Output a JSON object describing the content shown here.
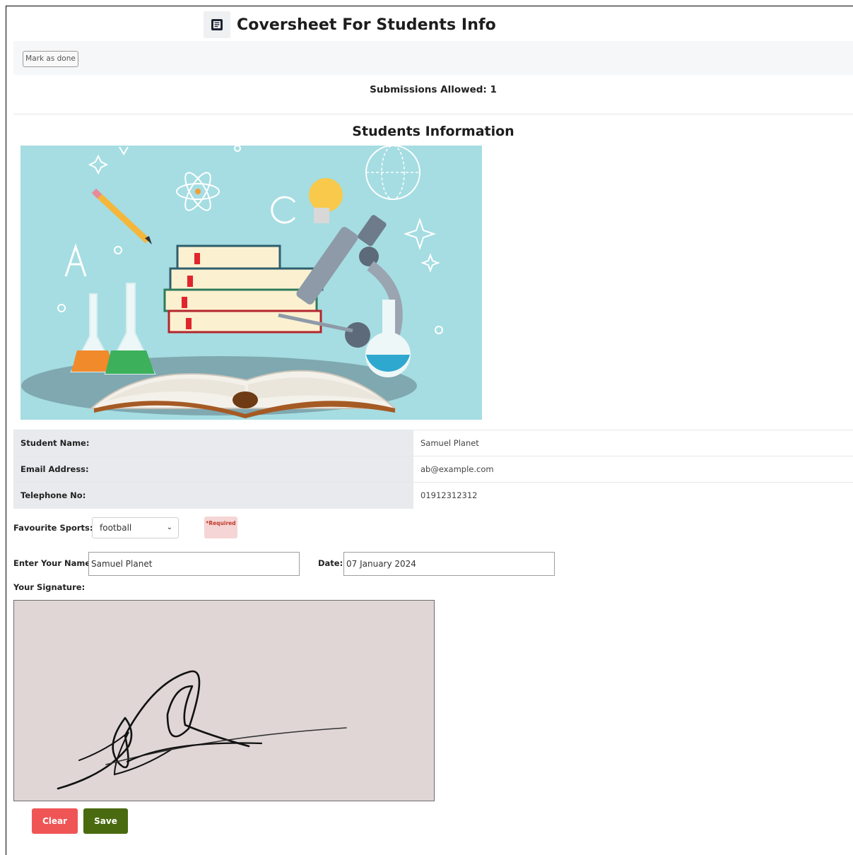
{
  "header": {
    "title": "Coversheet For Students Info",
    "icon": "document-icon"
  },
  "toolbar": {
    "mark_done_label": "Mark as done"
  },
  "submissions": {
    "text": "Submissions Allowed: 1"
  },
  "section": {
    "title": "Students Information"
  },
  "info_rows": [
    {
      "label": "Student Name:",
      "value": "Samuel Planet"
    },
    {
      "label": "Email Address:",
      "value": "ab@example.com"
    },
    {
      "label": "Telephone No:",
      "value": "01912312312"
    }
  ],
  "form": {
    "sports_label": "Favourite Sports:",
    "sports_value": "football",
    "required_badge": "*Required",
    "name_label": "Enter Your Name:",
    "name_value": "Samuel Planet",
    "date_label": "Date:",
    "date_value": "07 January 2024",
    "signature_label": "Your Signature:"
  },
  "buttons": {
    "clear": "Clear",
    "save": "Save"
  },
  "colors": {
    "clear_button": "#f05556",
    "save_button": "#4a6a10",
    "signature_bg": "#e0d6d6",
    "hero_bg": "#a5dde2"
  }
}
